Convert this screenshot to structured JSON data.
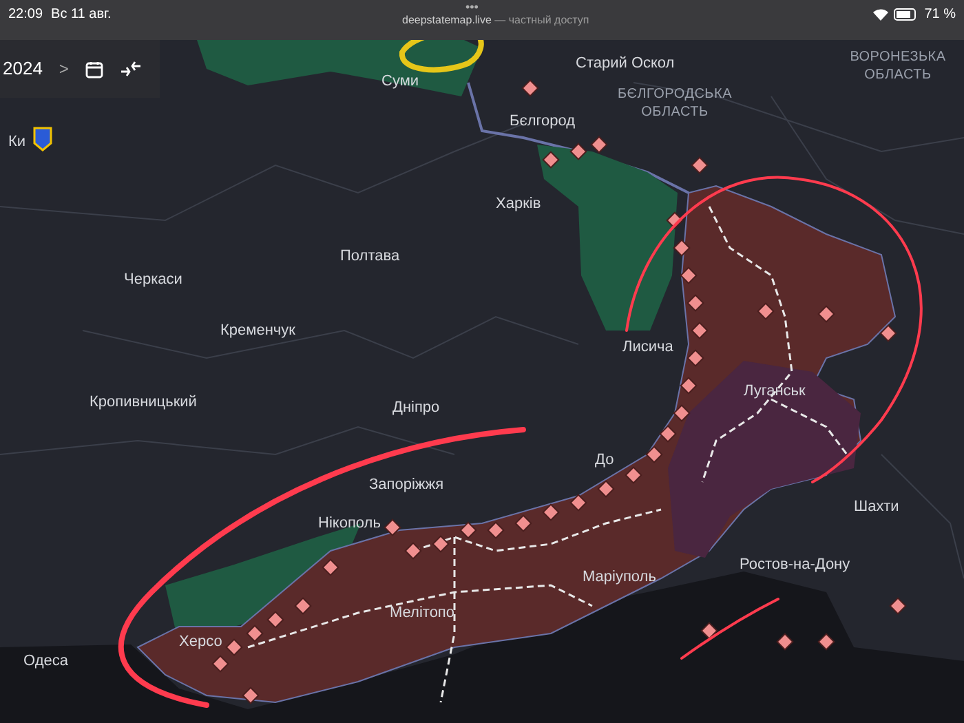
{
  "status_bar": {
    "time": "22:09",
    "date": "Вс 11 авг.",
    "battery": "71 %"
  },
  "address_bar": {
    "menu": "•••",
    "url": "deepstatemap.live",
    "suffix": " — частный доступ"
  },
  "controls": {
    "year": "2024",
    "next": ">"
  },
  "map": {
    "labels": [
      {
        "text": "Старий Оскол"
      },
      {
        "text": "ВОРОНЕЗЬКА ОБЛАСТЬ",
        "kind": "region"
      },
      {
        "text": "Суми"
      },
      {
        "text": "БЄЛГОРОДСЬКА ОБЛАСТЬ",
        "kind": "region"
      },
      {
        "text": "Бєлгород"
      },
      {
        "text": "Ки"
      },
      {
        "text": "Харків"
      },
      {
        "text": "Полтава"
      },
      {
        "text": "Черкаси"
      },
      {
        "text": "Кременчук"
      },
      {
        "text": "Лисича"
      },
      {
        "text": "Кропивницький"
      },
      {
        "text": "Луганськ"
      },
      {
        "text": "Дніпро"
      },
      {
        "text": "До"
      },
      {
        "text": "Запоріжжя"
      },
      {
        "text": "Шахти"
      },
      {
        "text": "Нікополь"
      },
      {
        "text": "Ростов-на-Дону"
      },
      {
        "text": "Маріуполь"
      },
      {
        "text": "Мелітопо"
      },
      {
        "text": "Херсо"
      },
      {
        "text": "Одеса"
      }
    ]
  }
}
